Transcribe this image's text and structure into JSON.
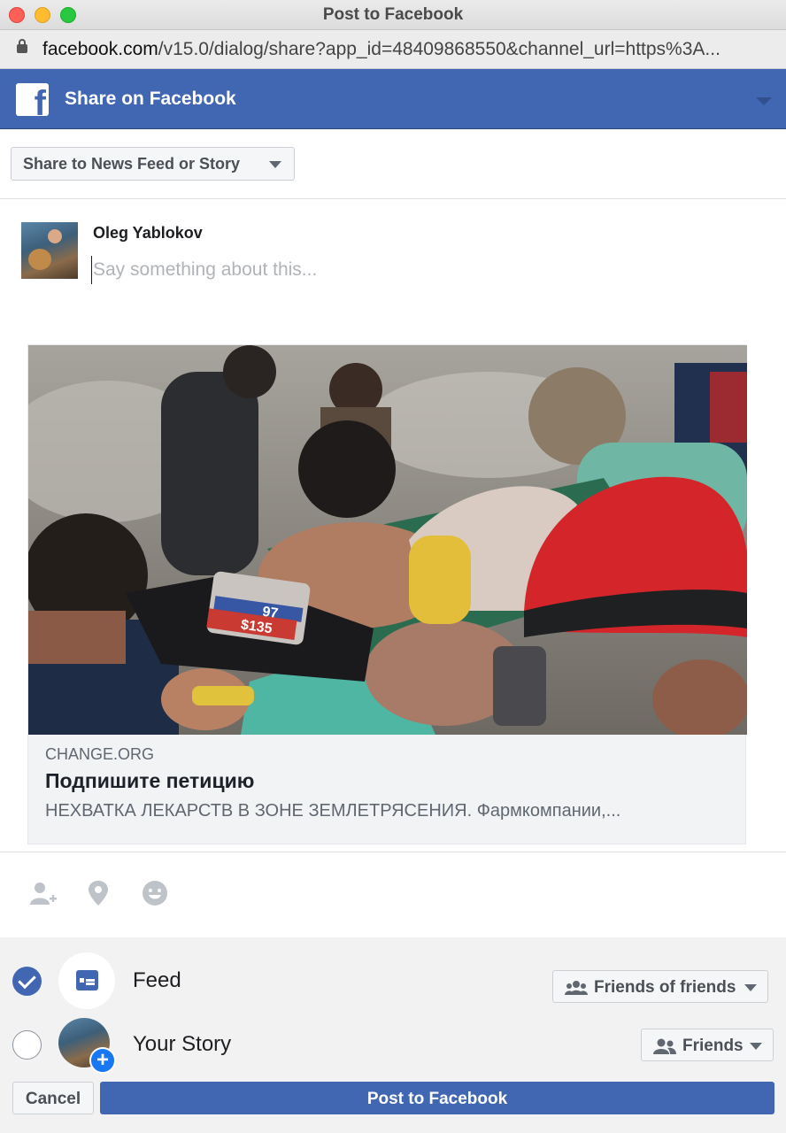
{
  "window": {
    "title": "Post to Facebook",
    "url_domain": "facebook.com",
    "url_path": "/v15.0/dialog/share?app_id=48409868550&channel_url=https%3A..."
  },
  "header": {
    "logo": "f",
    "title": "Share on Facebook"
  },
  "share_destination": {
    "selected": "Share to News Feed or Story"
  },
  "composer": {
    "user_name": "Oleg Yablokov",
    "placeholder": "Say something about this..."
  },
  "link_preview": {
    "domain": "CHANGE.ORG",
    "title": "Подпишите петицию",
    "description": "НЕХВАТКА ЛЕКАРСТВ В ЗОНЕ ЗЕМЛЕТРЯСЕНИЯ. Фармкомпании,...",
    "image_text": {
      "line1": "97",
      "line2": "$135"
    }
  },
  "actions": {
    "icons": [
      "tag-people-icon",
      "location-pin-icon",
      "feeling-smiley-icon"
    ]
  },
  "audience": {
    "feed": {
      "label": "Feed",
      "checked": true,
      "privacy": "Friends of friends"
    },
    "story": {
      "label": "Your Story",
      "checked": false,
      "privacy": "Friends",
      "badge": "+"
    }
  },
  "buttons": {
    "cancel": "Cancel",
    "post": "Post to Facebook"
  },
  "colors": {
    "brand": "#4267b2",
    "story_badge": "#1877f2"
  }
}
